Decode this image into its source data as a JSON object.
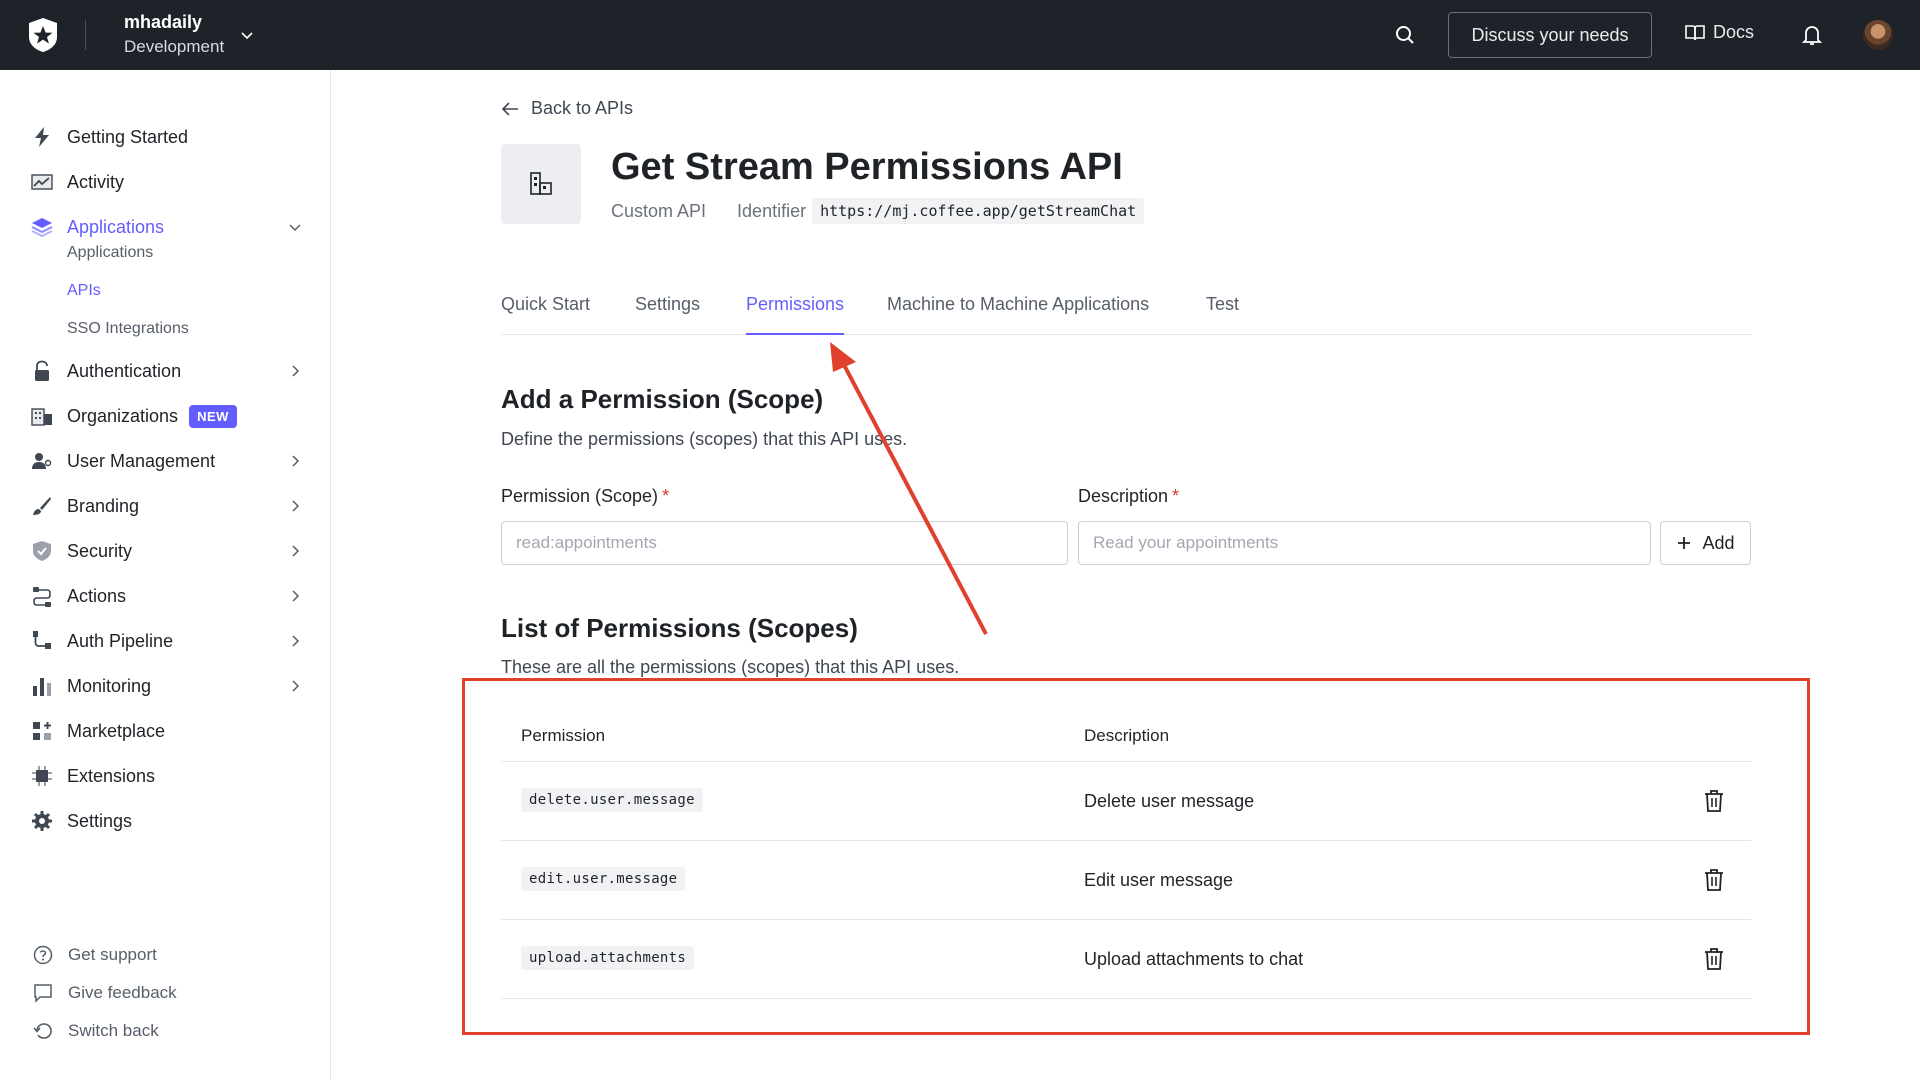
{
  "topbar": {
    "tenant_name": "mhadaily",
    "tenant_env": "Development",
    "discuss_label": "Discuss your needs",
    "docs_label": "Docs"
  },
  "sidebar": {
    "items": [
      {
        "label": "Getting Started",
        "icon": "bolt-icon"
      },
      {
        "label": "Activity",
        "icon": "activity-chart-icon"
      },
      {
        "label": "Applications",
        "icon": "layers-icon",
        "active": true,
        "expanded": true
      },
      {
        "label": "Authentication",
        "icon": "lock-icon"
      },
      {
        "label": "Organizations",
        "icon": "building-icon",
        "badge": "NEW"
      },
      {
        "label": "User Management",
        "icon": "users-icon"
      },
      {
        "label": "Branding",
        "icon": "brush-icon"
      },
      {
        "label": "Security",
        "icon": "shield-icon"
      },
      {
        "label": "Actions",
        "icon": "actions-flow-icon"
      },
      {
        "label": "Auth Pipeline",
        "icon": "pipeline-icon"
      },
      {
        "label": "Monitoring",
        "icon": "bar-chart-icon"
      },
      {
        "label": "Marketplace",
        "icon": "grid-plus-icon"
      },
      {
        "label": "Extensions",
        "icon": "chip-icon"
      },
      {
        "label": "Settings",
        "icon": "gear-icon"
      }
    ],
    "sub_items": [
      {
        "label": "Applications"
      },
      {
        "label": "APIs",
        "active": true
      },
      {
        "label": "SSO Integrations"
      }
    ],
    "footer": [
      {
        "label": "Get support",
        "icon": "help-circle-icon"
      },
      {
        "label": "Give feedback",
        "icon": "message-icon"
      },
      {
        "label": "Switch back",
        "icon": "undo-icon"
      }
    ]
  },
  "page": {
    "back_label": "Back to APIs",
    "title": "Get Stream Permissions API",
    "api_type": "Custom API",
    "identifier_label": "Identifier",
    "identifier_value": "https://mj.coffee.app/getStreamChat"
  },
  "tabs": [
    {
      "label": "Quick Start"
    },
    {
      "label": "Settings"
    },
    {
      "label": "Permissions",
      "active": true
    },
    {
      "label": "Machine to Machine Applications"
    },
    {
      "label": "Test"
    }
  ],
  "add_section": {
    "title": "Add a Permission (Scope)",
    "description": "Define the permissions (scopes) that this API uses.",
    "scope_label": "Permission (Scope)",
    "scope_placeholder": "read:appointments",
    "desc_label": "Description",
    "desc_placeholder": "Read your appointments",
    "required_mark": "*",
    "add_label": "Add"
  },
  "list_section": {
    "title": "List of Permissions (Scopes)",
    "description": "These are all the permissions (scopes) that this API uses.",
    "col_permission": "Permission",
    "col_description": "Description",
    "rows": [
      {
        "permission": "delete.user.message",
        "description": "Delete user message"
      },
      {
        "permission": "edit.user.message",
        "description": "Edit user message"
      },
      {
        "permission": "upload.attachments",
        "description": "Upload attachments to chat"
      }
    ]
  },
  "colors": {
    "accent": "#635dff",
    "topbar_bg": "#1e2229",
    "annotation": "#e0412d"
  }
}
